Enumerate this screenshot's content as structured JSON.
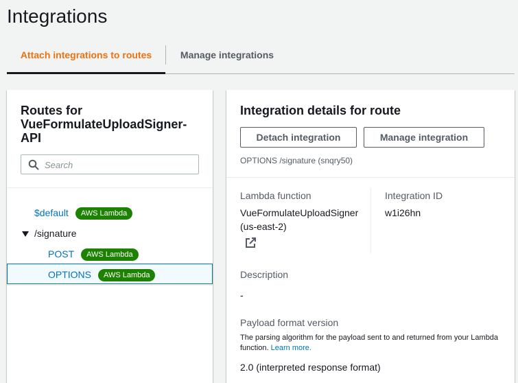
{
  "page": {
    "title": "Integrations"
  },
  "tabs": [
    {
      "label": "Attach integrations to routes",
      "active": true
    },
    {
      "label": "Manage integrations",
      "active": false
    }
  ],
  "routes_panel": {
    "title": "Routes for VueFormulateUploadSigner-API",
    "search": {
      "placeholder": "Search",
      "value": ""
    },
    "routes": [
      {
        "label": "$default",
        "badge": "AWS Lambda"
      },
      {
        "label": "/signature",
        "expanded": true
      },
      {
        "label": "POST",
        "badge": "AWS Lambda"
      },
      {
        "label": "OPTIONS",
        "badge": "AWS Lambda",
        "selected": true
      }
    ]
  },
  "details_panel": {
    "title": "Integration details for route",
    "detach_label": "Detach integration",
    "manage_label": "Manage integration",
    "route_id": "OPTIONS /signature (snqry50)",
    "lambda_label": "Lambda function",
    "lambda_name": "VueFormulateUploadSigner",
    "lambda_region": "(us-east-2)",
    "integration_id_label": "Integration ID",
    "integration_id": "w1i26hn",
    "description_label": "Description",
    "description_value": "-",
    "payload_label": "Payload format version",
    "payload_help": "The parsing algorithm for the payload sent to and returned from your Lambda function.",
    "learn_more": "Learn more.",
    "payload_value": "2.0 (interpreted response format)"
  },
  "colors": {
    "accent": "#ec7211",
    "link": "#0073bb",
    "badge": "#1d8102"
  }
}
